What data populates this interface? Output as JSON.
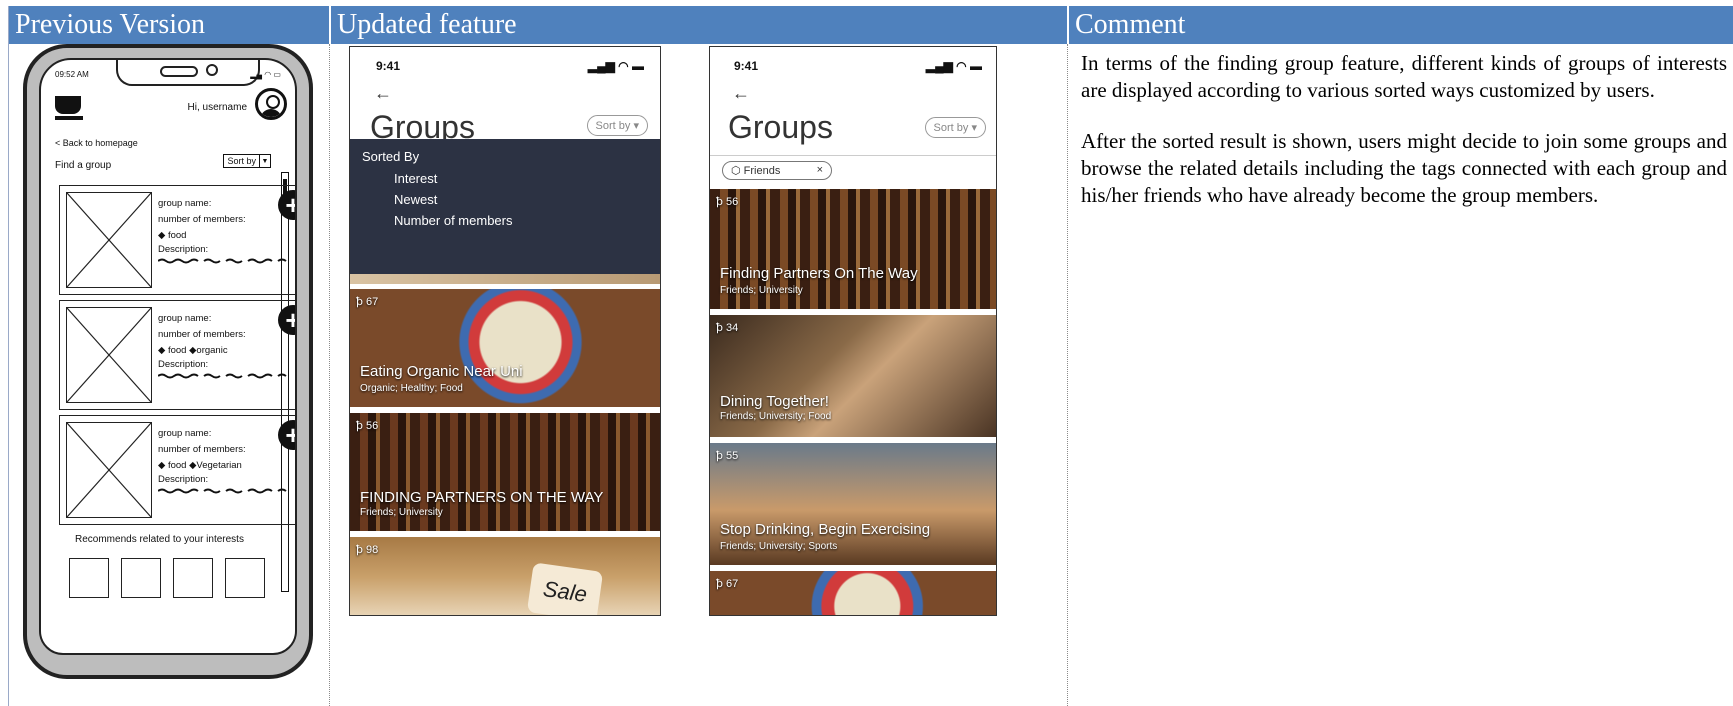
{
  "headers": {
    "col1": "Previous Version",
    "col2": "Updated feature",
    "col3": "Comment"
  },
  "wireframe": {
    "time": "09:52 AM",
    "greeting": "Hi, username",
    "back": "< Back to homepage",
    "find": "Find a group",
    "sort": "Sort by",
    "cards": [
      {
        "name": "group name:",
        "members": "number of members:",
        "tags": [
          "food"
        ],
        "desc": "Description:"
      },
      {
        "name": "group name:",
        "members": "number of members:",
        "tags": [
          "food",
          "organic"
        ],
        "desc": "Description:"
      },
      {
        "name": "group name:",
        "members": "number of members:",
        "tags": [
          "food",
          "Vegetarian"
        ],
        "desc": "Description:"
      }
    ],
    "recommend": "Recommends related to your interests"
  },
  "mock1": {
    "time": "9:41",
    "back": "←",
    "title": "Groups",
    "sort": "Sort by",
    "dropdown_title": "Sorted By",
    "dropdown_items": [
      "Interest",
      "Newest",
      "Number of members"
    ],
    "cards": [
      {
        "count": "67",
        "title": "Eating Organic Near Uni",
        "sub": "Organic; Healthy; Food"
      },
      {
        "count": "56",
        "title": "FINDING PARTNERS ON THE WAY",
        "sub": "Friends; University"
      },
      {
        "count": "98",
        "title": "",
        "sub": ""
      }
    ]
  },
  "mock2": {
    "time": "9:41",
    "back": "←",
    "title": "Groups",
    "sort": "Sort by",
    "filter": "Friends",
    "cards": [
      {
        "count": "56",
        "title": "Finding Partners On The Way",
        "sub": "Friends; University"
      },
      {
        "count": "34",
        "title": "Dining Together!",
        "sub": "Friends; University; Food"
      },
      {
        "count": "55",
        "title": "Stop Drinking, Begin Exercising",
        "sub": "Friends; University; Sports"
      },
      {
        "count": "67",
        "title": "",
        "sub": ""
      }
    ]
  },
  "comment": {
    "p1": "In terms of the finding group feature, different kinds of groups of interests are displayed according to various sorted ways customized by users.",
    "p2": "After the sorted result is shown, users might decide to join some groups and browse the related details including the tags connected with each group and his/her friends who have already become the group members."
  }
}
